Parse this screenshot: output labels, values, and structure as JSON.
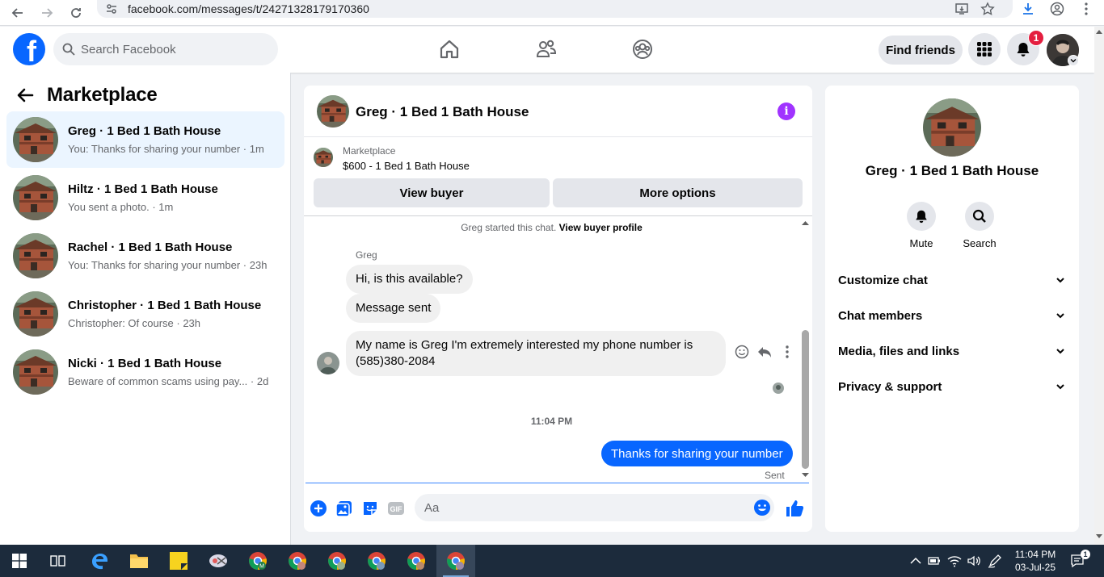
{
  "browser": {
    "url": "facebook.com/messages/t/24271328179170360"
  },
  "header": {
    "logo": "f",
    "search_placeholder": "Search Facebook",
    "find_friends": "Find friends",
    "notifications_count": "1"
  },
  "sidebar": {
    "title": "Marketplace",
    "conversations": [
      {
        "name": "Greg · 1 Bed 1 Bath House",
        "preview": "You: Thanks for sharing your number · 1m"
      },
      {
        "name": "Hiltz · 1 Bed 1 Bath House",
        "preview": "You sent a photo. · 1m"
      },
      {
        "name": "Rachel · 1 Bed 1 Bath House",
        "preview": "You: Thanks for sharing your number · 23h"
      },
      {
        "name": "Christopher · 1 Bed 1 Bath House",
        "preview": "Christopher: Of course · 23h"
      },
      {
        "name": "Nicki · 1 Bed 1 Bath House",
        "preview": "Beware of common scams using pay... · 2d"
      }
    ]
  },
  "chat": {
    "title": "Greg · 1 Bed 1 Bath House",
    "info_icon": "i",
    "marketplace_label": "Marketplace",
    "listing": "$600 - 1 Bed 1 Bath House",
    "view_buyer": "View buyer",
    "more_options": "More options",
    "started_text": "Greg started this chat.",
    "view_profile": "View buyer profile",
    "sender": "Greg",
    "messages_in": [
      "Hi, is this available?",
      "Message sent",
      "My name is Greg I'm extremely interested my phone number is (585)380-2084"
    ],
    "time": "11:04 PM",
    "message_out": "Thanks for sharing your number",
    "status": "Sent",
    "input_placeholder": "Aa"
  },
  "details": {
    "name": "Greg · 1 Bed 1 Bath House",
    "mute": "Mute",
    "search": "Search",
    "sections": [
      "Customize chat",
      "Chat members",
      "Media, files and links",
      "Privacy & support"
    ]
  },
  "taskbar": {
    "time": "11:04 PM",
    "date": "03-Jul-25"
  },
  "colors": {
    "accent": "#0866ff",
    "info": "#a033ff",
    "badge": "#e41e3f"
  }
}
